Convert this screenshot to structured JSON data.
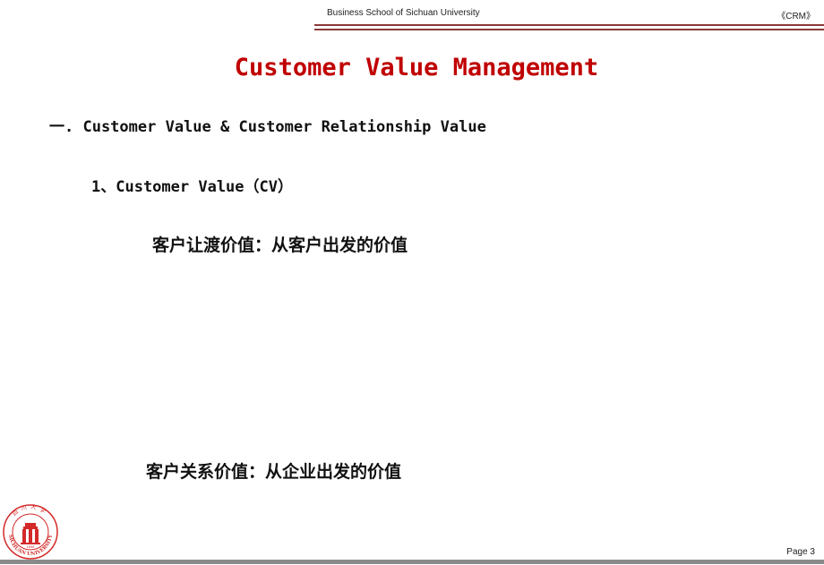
{
  "header": {
    "institution": "Business School of Sichuan University",
    "course": "《CRM》"
  },
  "slide": {
    "title": "Customer Value Management",
    "section_heading": "一. Customer Value & Customer Relationship Value",
    "subsection_heading": "1、Customer Value（CV）",
    "points": [
      "客户让渡价值：从客户出发的价值",
      "客户关系价值：从企业出发的价值"
    ]
  },
  "logo": {
    "top_text": "四川大学",
    "bottom_text": "SICHUAN UNIVERSITY",
    "year": "1896",
    "color": "#d42a2a"
  },
  "footer": {
    "page_label": "Page 3"
  },
  "colors": {
    "title": "#c00000",
    "header_rule": "#8b3a36",
    "footer_bar": "#8a8a8a"
  }
}
